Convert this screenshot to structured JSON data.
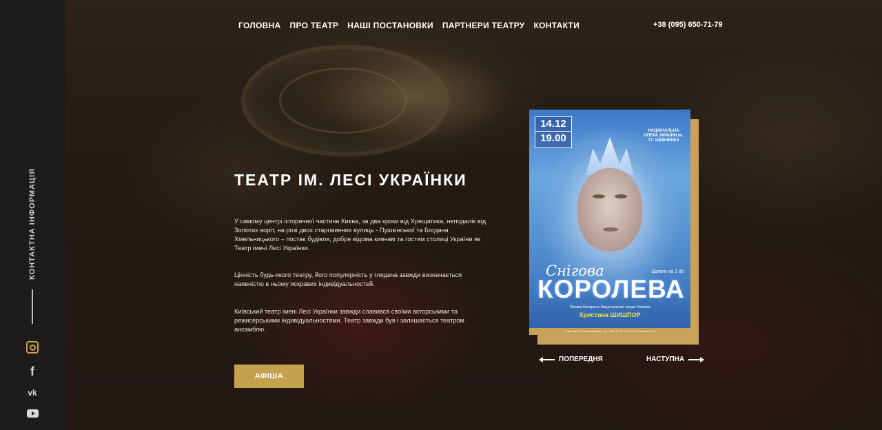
{
  "nav": {
    "items": [
      "ГОЛОВНА",
      "ПРО ТЕАТР",
      "НАШІ ПОСТАНОВКИ",
      "ПАРТНЕРИ ТЕАТРУ",
      "КОНТАКТИ"
    ],
    "phone": "+38 (095) 650-71-79"
  },
  "sidebar": {
    "label": "КОНТАКТНА ІНФОРМАЦІЯ",
    "socials": [
      "instagram-icon",
      "facebook-icon",
      "vk-icon",
      "youtube-icon"
    ],
    "vk_text": "vk",
    "fb_text": "f"
  },
  "main": {
    "title": "ТЕАТР ІМ. ЛЕСІ УКРАЇНКИ",
    "paragraphs": [
      "У самому центрі історичної частини Києва, за два кроки від Хрещатика, неподалік від Золотих воріт, на розі двох старовинних вулиць - Пушкінської та Богдана Хмельницького – постає будівля, добре відома киянам та гостям столиці України як Театр імені Лесі Українки.",
      "Цінність будь-якого театру, його популярність у глядача завжди визначається наявністю в ньому яскравих індивідуальностей.",
      "Київський театр імені Лесі Українки завжди славився своїми акторськими та режисерськими індивідуальностями. Театр завжди був і залишається театром ансамблю."
    ],
    "button_label": "АФІША"
  },
  "poster": {
    "date": "14.12",
    "time": "19.00",
    "opera": "НАЦІОНАЛЬНА ОПЕРА УКРАЇНИ ім. Т.Г. ШЕВЧЕНКА",
    "script_title": "Снігова",
    "main_title": "КОРОЛЕВА",
    "subtitle": "Балет на 2 дії",
    "small": "Прима-балерина Національної опери України",
    "name": "Христина ШИШПОР",
    "strip": "м.Київ вул. Б.Хмельницького, тел.: 234-47-80, 234-47-80 www.kassa.ua"
  },
  "slider": {
    "prev_label": "ПОПЕРЕДНЯ",
    "next_label": "НАСТУПНА"
  },
  "colors": {
    "accent": "#c5a14d",
    "sidebar": "#1e1c1b"
  }
}
